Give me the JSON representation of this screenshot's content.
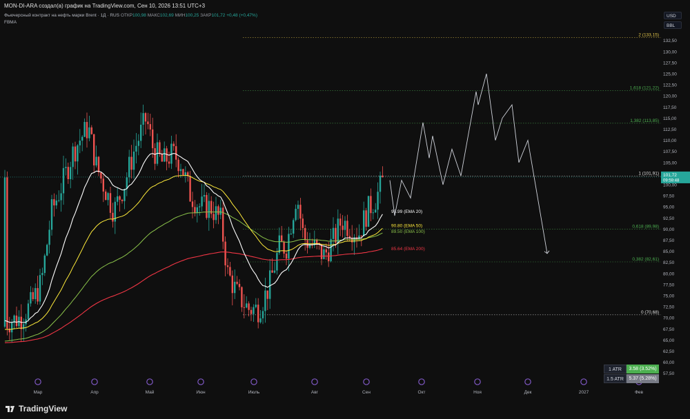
{
  "header": {
    "caption": "MON-DI-ARA создал(а) график на TradingView.com, Сен 10, 2026 13:51 UTC+3"
  },
  "legend": {
    "symbol": "Фьючерсный контракт на нефть марки Brent · 1Д · RUS",
    "open_label": "ОТКР",
    "open": "100,98",
    "high_label": "МАКС",
    "high": "102,69",
    "low_label": "МИН",
    "low": "100,25",
    "close_label": "ЗАКР",
    "close": "101,72",
    "change": "+0,48 (+0,47%)",
    "indicator": "FBMA"
  },
  "price_scale": {
    "currency": "USD",
    "unit": "BBL",
    "ticks": [
      "132,50",
      "130,00",
      "127,50",
      "125,00",
      "122,50",
      "120,00",
      "117,50",
      "115,00",
      "112,50",
      "110,00",
      "107,50",
      "105,00",
      "102,50",
      "100,00",
      "97,50",
      "95,00",
      "92,50",
      "90,00",
      "87,50",
      "85,00",
      "82,50",
      "80,00",
      "77,50",
      "75,00",
      "72,50",
      "70,00",
      "67,50",
      "65,00",
      "62,50",
      "60,00",
      "57,50"
    ],
    "current_price": "101,72",
    "countdown": "09:59:48"
  },
  "fib_levels": [
    {
      "label": "2 (133,15)",
      "price": 133.15,
      "color": "#e6c84b"
    },
    {
      "label": "1,618 (121,22)",
      "price": 121.22,
      "color": "#4caf50"
    },
    {
      "label": "1,382 (113,85)",
      "price": 113.85,
      "color": "#4caf50"
    },
    {
      "label": "1 (101,91)",
      "price": 101.91,
      "color": "#e0e0e0"
    },
    {
      "label": "0,618 (89,98)",
      "price": 89.98,
      "color": "#4caf50"
    },
    {
      "label": "0,382 (82,61)",
      "price": 82.61,
      "color": "#4caf50"
    },
    {
      "label": "0 (70,68)",
      "price": 70.68,
      "color": "#e0e0e0"
    }
  ],
  "ema_labels": [
    {
      "label": "93.99 (EMA 20)",
      "price": 93.99,
      "color": "#ffffff"
    },
    {
      "label": "90.80 (EMA 50)",
      "price": 90.8,
      "color": "#ffeb3b"
    },
    {
      "label": "89.50 (EMA 100)",
      "price": 89.5,
      "color": "#8bc34a"
    },
    {
      "label": "85.64 (EMA 200)",
      "price": 85.64,
      "color": "#f23645"
    }
  ],
  "time_axis": [
    "Мар",
    "Апр",
    "Май",
    "Июн",
    "Июль",
    "Авг",
    "Сен",
    "Окт",
    "Ноя",
    "Дек",
    "2027",
    "Фев"
  ],
  "atr": [
    {
      "key": "1 ATR",
      "value": "3.58 (3.52%)",
      "color": "#4caf50"
    },
    {
      "key": "1.5 ATR",
      "value": "5.37 (5.28%)",
      "color": "#787b86"
    }
  ],
  "colors": {
    "up": "#26a69a",
    "down": "#ef5350",
    "background": "#0f0f0f",
    "projection": "#d1d4dc"
  },
  "brand": "TradingView"
}
